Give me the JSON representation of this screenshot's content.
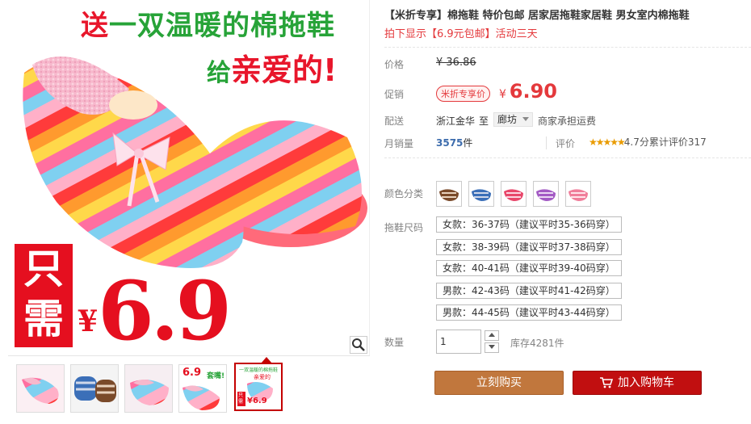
{
  "promo": {
    "line1_red": "送",
    "line1_green": "一双温暖的棉拖鞋",
    "line2_green": "给",
    "line2_red": "亲爱的!",
    "only_char1": "只",
    "only_char2": "需",
    "yen": "¥",
    "big_price": "6.9"
  },
  "thumbs": {
    "t4_price": "6.9",
    "t4_text": "套嘴!",
    "t5_text": "一双温暖的棉拖鞋",
    "t5_sub": "亲爱的",
    "t5_price": "¥6.9",
    "t5_only": "只需"
  },
  "product": {
    "title": "【米折专享】棉拖鞋 特价包邮 居家居拖鞋家居鞋 男女室内棉拖鞋",
    "subtitle": "拍下显示【6.9元包邮】活动三天"
  },
  "price": {
    "label": "价格",
    "original": "¥ 36.86",
    "promo_label": "促销",
    "promo_tag": "米折专享价",
    "yen": "¥",
    "current": "6.90"
  },
  "shipping": {
    "label": "配送",
    "origin": "浙江金华",
    "to": "至",
    "destination": "廊坊",
    "fee": "商家承担运费"
  },
  "sales": {
    "label": "月销量",
    "count": "3575",
    "unit": "件",
    "review_label": "评价",
    "stars": "★★★★★",
    "score": "4.7分",
    "total_label": "累计评价",
    "total": "317"
  },
  "color": {
    "label": "颜色分类",
    "swatches": [
      "brown",
      "blue",
      "pink",
      "purple",
      "rose"
    ]
  },
  "size": {
    "label": "拖鞋尺码",
    "options": [
      "女款：36-37码（建议平时35-36码穿）",
      "女款：38-39码（建议平时37-38码穿）",
      "女款：40-41码（建议平时39-40码穿）",
      "男款：42-43码（建议平时41-42码穿）",
      "男款：44-45码（建议平时43-44码穿）"
    ]
  },
  "quantity": {
    "label": "数量",
    "value": "1",
    "stock": "库存4281件"
  },
  "actions": {
    "buy_now": "立刻购买",
    "add_to_cart": "加入购物车"
  },
  "icons": {
    "zoom": "magnifier-icon",
    "cart": "cart-icon",
    "dropdown": "caret-down-icon"
  },
  "colors": {
    "accent_red": "#e4393c",
    "buy_button": "#c1773d",
    "cart_button": "#c10f10"
  }
}
